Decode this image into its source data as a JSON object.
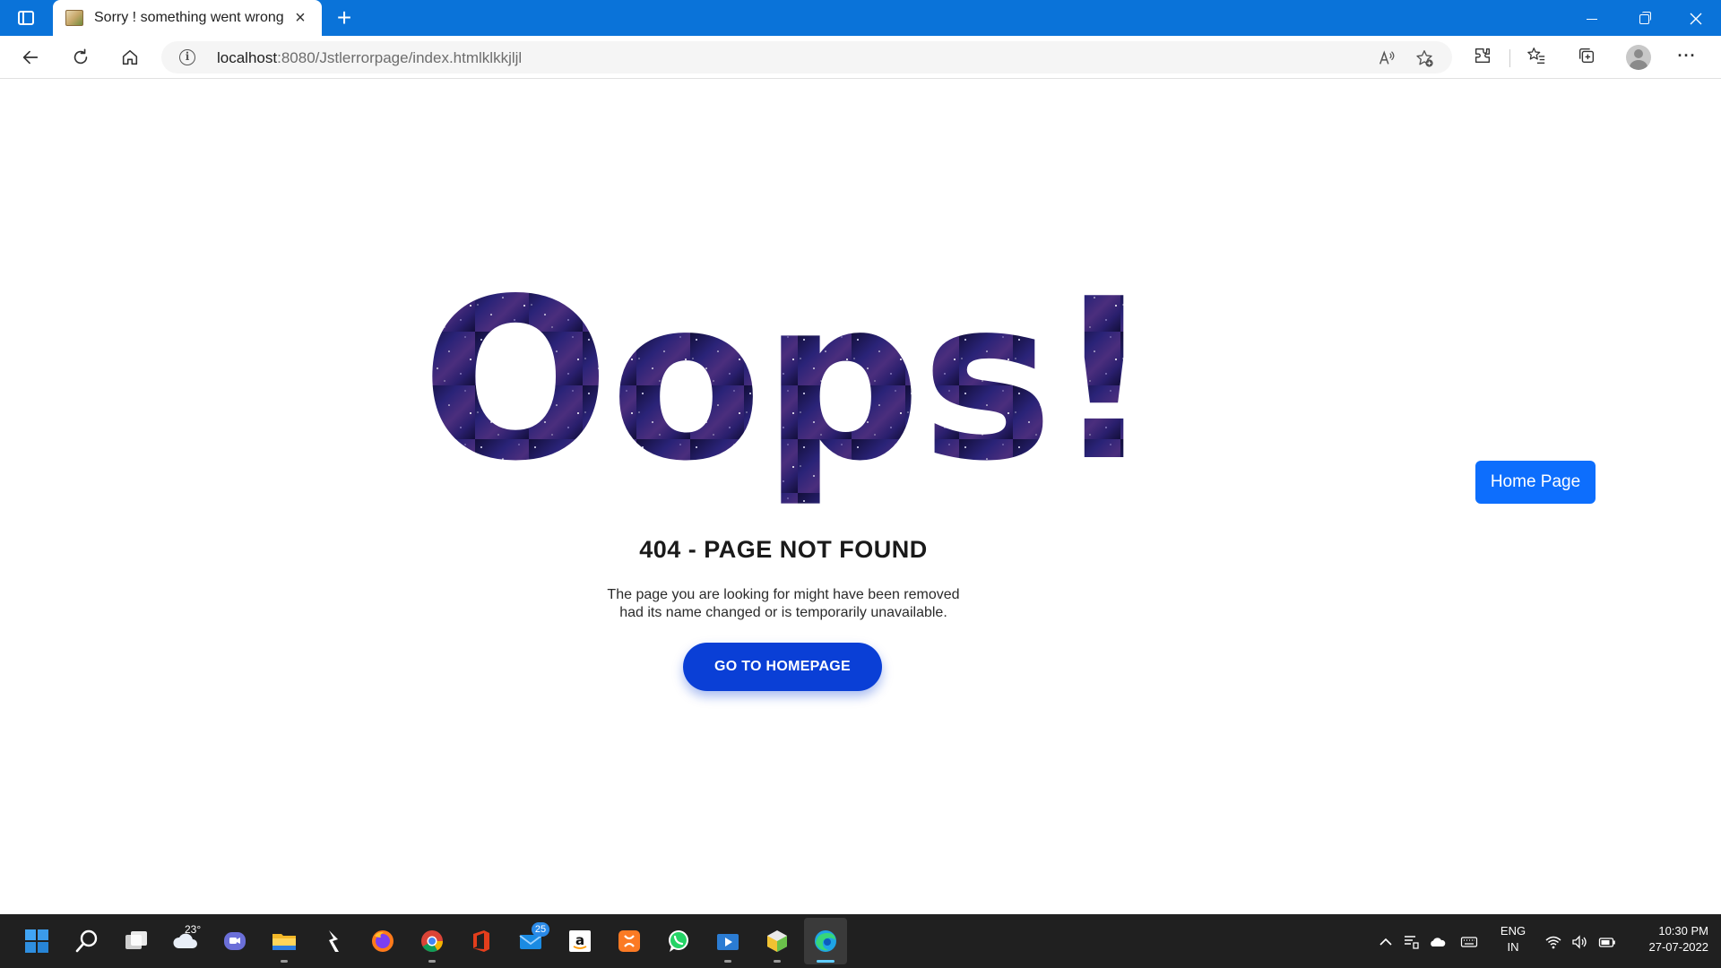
{
  "browser": {
    "tab_title": "Sorry ! something went wrong",
    "new_tab_symbol": "+",
    "tab_close_symbol": "×",
    "url_host": "localhost",
    "url_rest": ":8080/Jstlerrorpage/index.htmlklkkjljl",
    "more_symbol": "···",
    "colors": {
      "titlebar": "#0a73d9",
      "tab_bg": "#ffffff"
    },
    "icons": [
      "tab-actions-icon",
      "favicon-icon",
      "close-icon",
      "plus-icon",
      "minimize-icon",
      "restore-icon",
      "close-window-icon",
      "back-arrow-icon",
      "refresh-icon",
      "home-icon",
      "info-icon",
      "read-aloud-icon",
      "add-favorite-icon",
      "extensions-icon",
      "favorites-icon",
      "collections-icon",
      "profile-avatar-icon",
      "more-icon"
    ]
  },
  "page": {
    "headline": "Oops!",
    "error_title": "404 - PAGE NOT FOUND",
    "description_line1": "The page you are looking for might have been removed",
    "description_line2": "had its name changed or is temporarily unavailable.",
    "primary_button": "GO TO HOMEPAGE",
    "secondary_button": "Home Page",
    "colors": {
      "primary_button": "#0a3fd6",
      "secondary_button": "#0d6efd",
      "headline_fill": "#2a1f6e"
    }
  },
  "taskbar": {
    "weather_temp": "23°",
    "mail_badge": "25",
    "language": "ENG",
    "region": "IN",
    "time": "10:30 PM",
    "date": "27-07-2022",
    "icons": [
      "windows-start-icon",
      "search-icon",
      "task-view-icon",
      "weather-icon",
      "teams-chat-icon",
      "file-explorer-icon",
      "cursor-app-icon",
      "firefox-icon",
      "chrome-icon",
      "office-icon",
      "mail-icon",
      "amazon-icon",
      "xampp-icon",
      "whatsapp-icon",
      "media-player-icon",
      "app-package-icon",
      "edge-icon",
      "chevron-up-icon",
      "notification-icon",
      "onedrive-icon",
      "keyboard-icon",
      "wifi-icon",
      "volume-icon",
      "battery-icon"
    ]
  }
}
